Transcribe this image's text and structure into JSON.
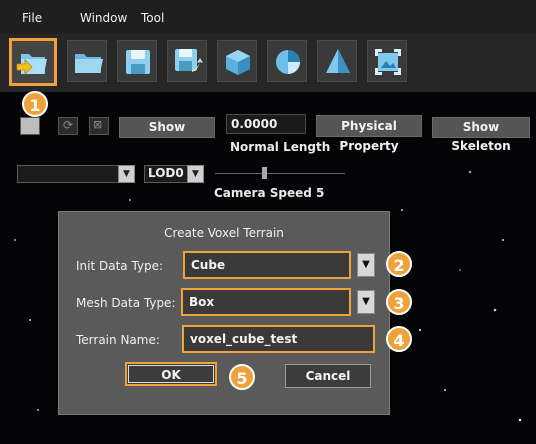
{
  "menu": {
    "file": "File",
    "window": "Window",
    "tool": "Tool"
  },
  "toolbar": {
    "buttons": [
      {
        "icon": "open-folder-import-icon"
      },
      {
        "icon": "folder-icon"
      },
      {
        "icon": "save-icon"
      },
      {
        "icon": "save-as-icon"
      },
      {
        "icon": "cube-icon"
      },
      {
        "icon": "pie-shape-icon"
      },
      {
        "icon": "pyramid-icon"
      },
      {
        "icon": "image-frame-icon"
      }
    ]
  },
  "controls": {
    "show_label": "Show",
    "normal_length_value": "0.0000",
    "normal_length_label": "Normal Length",
    "physical_property_label": "Physical Property",
    "show_skeleton_label": "Show Skeleton",
    "lod_value": "LOD0",
    "camera_speed_label": "Camera Speed 5"
  },
  "dialog": {
    "title": "Create Voxel Terrain",
    "init_data_type_label": "Init Data Type:",
    "init_data_type_value": "Cube",
    "mesh_data_type_label": "Mesh Data Type:",
    "mesh_data_type_value": "Box",
    "terrain_name_label": "Terrain Name:",
    "terrain_name_value": "voxel_cube_test",
    "ok_label": "OK",
    "cancel_label": "Cancel"
  },
  "callouts": {
    "c1": "1",
    "c2": "2",
    "c3": "3",
    "c4": "4",
    "c5": "5"
  },
  "colors": {
    "accent": "#f0a23a",
    "background": "#050508",
    "toolbar": "#262626",
    "dialog": "#5a5a5a"
  }
}
